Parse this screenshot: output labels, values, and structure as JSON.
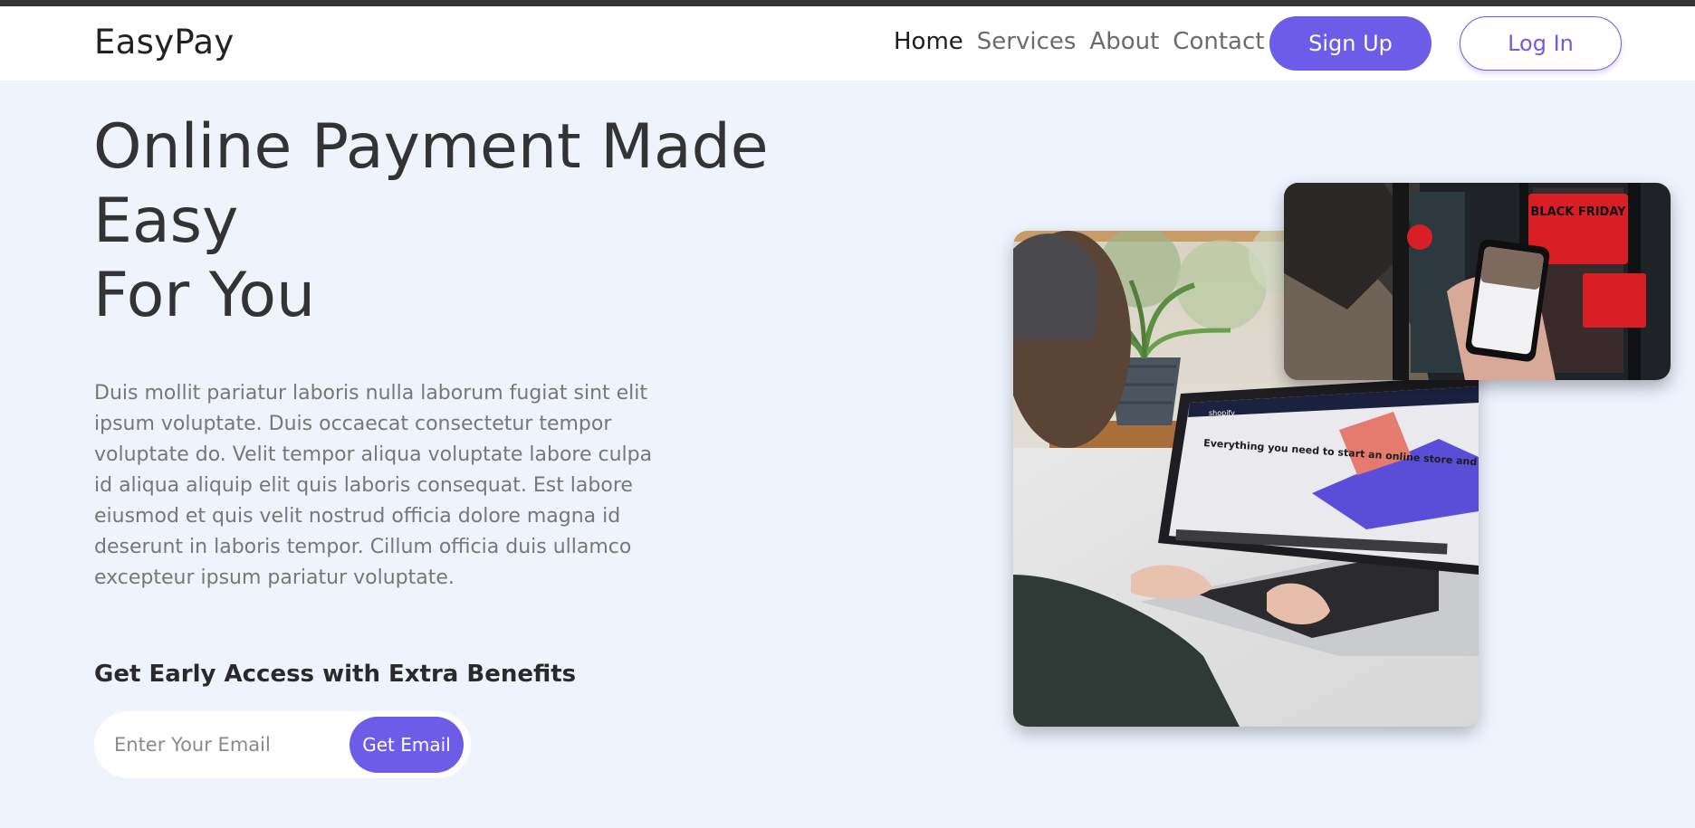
{
  "brand": {
    "name": "EasyPay",
    "accent": "#6c5ce7"
  },
  "nav": {
    "links": [
      {
        "label": "Home",
        "active": true
      },
      {
        "label": "Services",
        "active": false
      },
      {
        "label": "About",
        "active": false
      },
      {
        "label": "Contact",
        "active": false
      }
    ],
    "signup_label": "Sign Up",
    "login_label": "Log In"
  },
  "hero": {
    "title_lines": [
      "Online Payment Made",
      "Easy",
      "For You"
    ],
    "description": "Duis mollit pariatur laboris nulla laborum fugiat sint elit ipsum voluptate. Duis occaecat consectetur tempor voluptate do. Velit tempor aliqua voluptate labore culpa id aliqua aliquip elit quis laboris consequat. Est labore eiusmod et quis velit nostrud officia dolore magna id deserunt in laboris tempor. Cillum officia duis ullamco excepteur ipsum pariatur voluptate.",
    "access_title": "Get Early Access with Extra Benefits",
    "email_placeholder": "Enter Your Email",
    "cta_label": "Get Email"
  },
  "images": {
    "laptop_screen_text": "Everything you need to start an online store and sell online",
    "laptop_site_brand": "shopify",
    "phone_sign_text": "BLACK FRIDAY"
  },
  "colors": {
    "page_bg": "#eef3fd",
    "nav_bg": "#ffffff",
    "title": "#333333",
    "body_text": "#777777",
    "top_strip": "#333436"
  }
}
